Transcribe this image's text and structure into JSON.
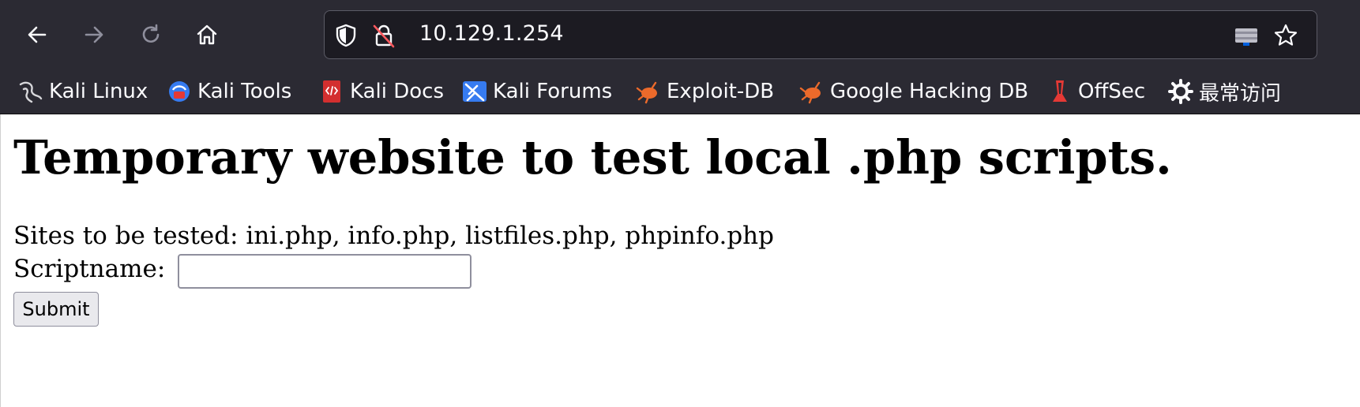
{
  "browser": {
    "url": "10.129.1.254",
    "bookmarks": [
      {
        "label": "Kali Linux",
        "icon": "kali-dragon-icon"
      },
      {
        "label": "Kali Tools",
        "icon": "kali-tools-icon"
      },
      {
        "label": "Kali Docs",
        "icon": "kali-docs-icon"
      },
      {
        "label": "Kali Forums",
        "icon": "kali-forums-icon"
      },
      {
        "label": "Exploit-DB",
        "icon": "exploit-db-icon"
      },
      {
        "label": "Google Hacking DB",
        "icon": "ghdb-icon"
      },
      {
        "label": "OffSec",
        "icon": "offsec-icon"
      },
      {
        "label": "最常访问",
        "icon": "gear-icon"
      }
    ],
    "colors": {
      "toolbar": "#2b2a33",
      "urlbar": "#1c1b22",
      "text": "#fbfbfe"
    }
  },
  "page": {
    "heading": "Temporary website to test local .php scripts.",
    "sites_line": "Sites to be tested: ini.php, info.php, listfiles.php, phpinfo.php",
    "scriptname_label": "Scriptname:",
    "scriptname_value": "",
    "submit_label": "Submit"
  }
}
